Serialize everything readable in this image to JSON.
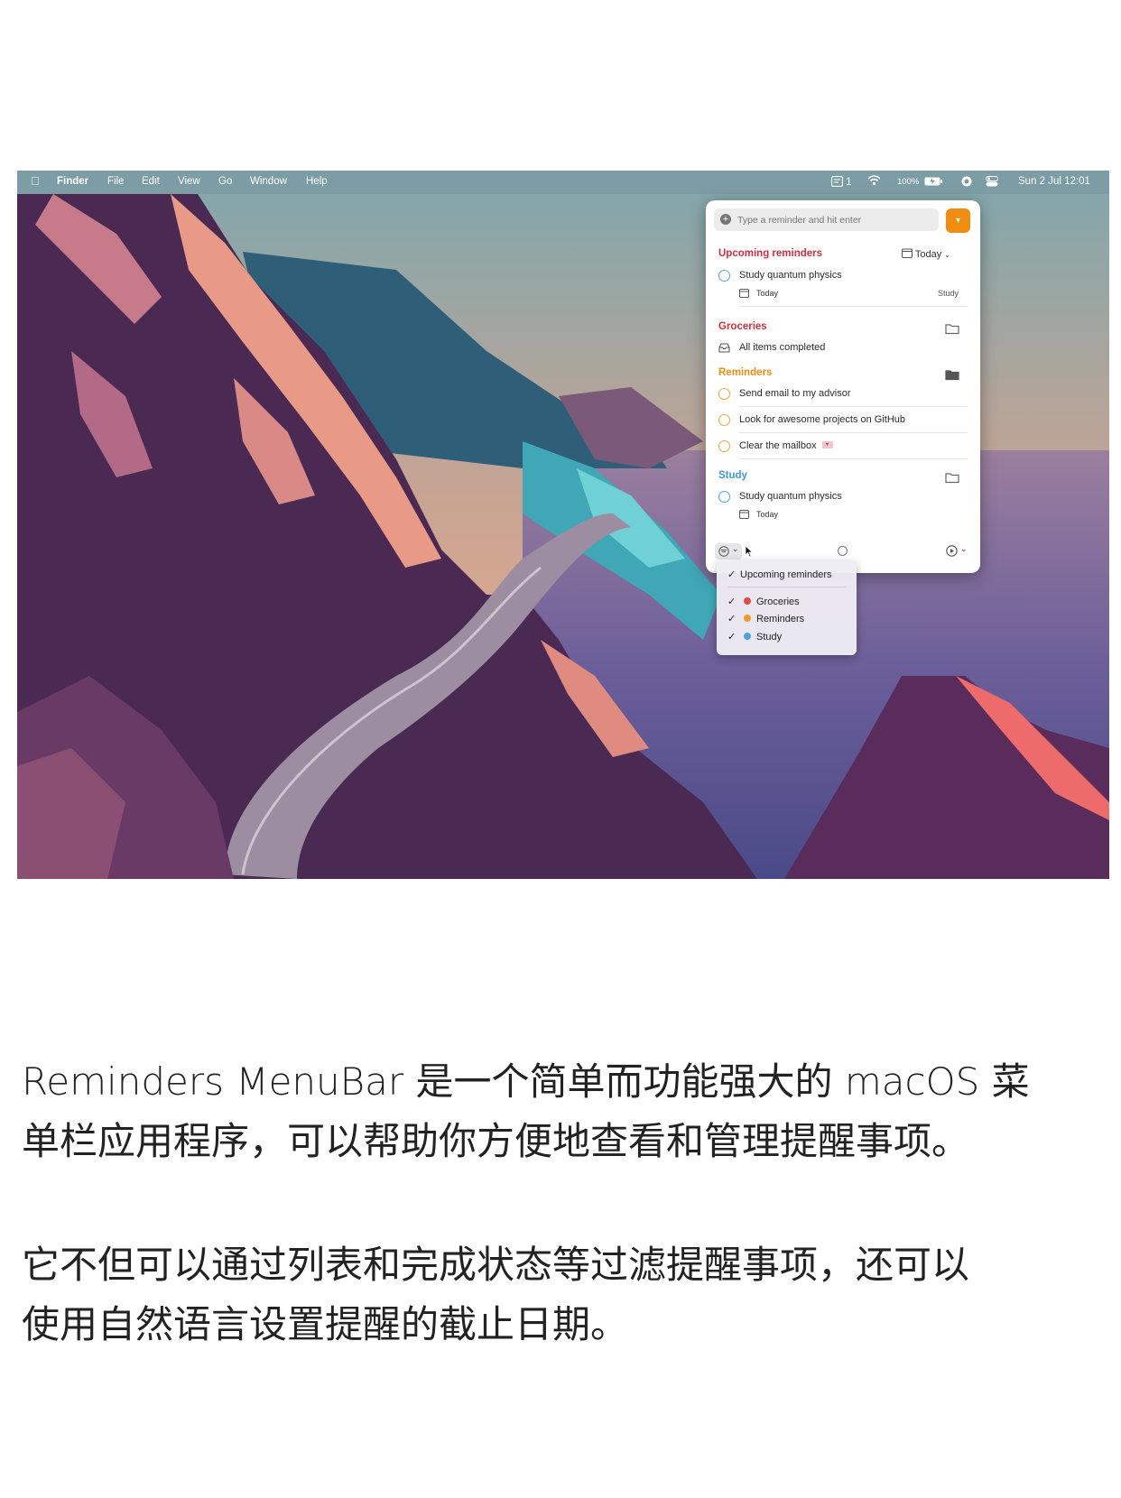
{
  "menubar": {
    "app": "Finder",
    "menus": [
      "File",
      "Edit",
      "View",
      "Go",
      "Window",
      "Help"
    ],
    "reminder_count": "1",
    "battery": "100%",
    "datetime": "Sun 2 Jul 12:01"
  },
  "popover": {
    "input_placeholder": "Type a reminder and hit enter",
    "upcoming": {
      "title": "Upcoming reminders",
      "filter": "Today",
      "item": {
        "title": "Study quantum physics",
        "date": "Today",
        "list": "Study"
      }
    },
    "groceries": {
      "title": "Groceries",
      "status": "All items completed"
    },
    "reminders": {
      "title": "Reminders",
      "items": [
        "Send email to my advisor",
        "Look for awesome projects on GitHub",
        "Clear the mailbox"
      ]
    },
    "study": {
      "title": "Study",
      "item": {
        "title": "Study quantum physics",
        "date": "Today"
      }
    }
  },
  "dropdown": {
    "items": [
      {
        "label": "Upcoming reminders",
        "checked": true
      },
      {
        "label": "Groceries",
        "checked": true,
        "color": "#e8473f"
      },
      {
        "label": "Reminders",
        "checked": true,
        "color": "#f29a26"
      },
      {
        "label": "Study",
        "checked": true,
        "color": "#4aa3e0"
      }
    ]
  },
  "colors": {
    "upcoming": "#d32f3f",
    "groceries": "#d32f3f",
    "reminders": "#f08c10",
    "study": "#3d9ae0"
  },
  "caption": {
    "p1_line1": "Reminders MenuBar 是一个简单而功能强大的 macOS 菜",
    "p1_line2": "单栏应用程序，可以帮助你方便地查看和管理提醒事项。",
    "p2_line1": "它不但可以通过列表和完成状态等过滤提醒事项，还可以",
    "p2_line2": "使用自然语言设置提醒的截止日期。"
  }
}
